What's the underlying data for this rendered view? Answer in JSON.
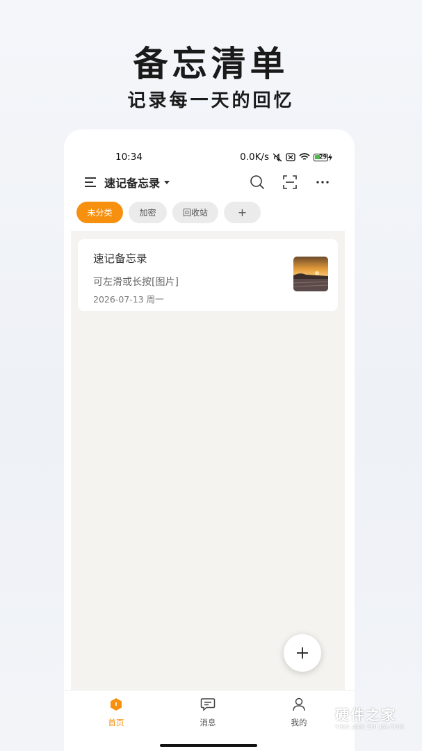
{
  "promo": {
    "title": "备忘清单",
    "subtitle": "记录每一天的回忆"
  },
  "status_bar": {
    "time": "10:34",
    "net_speed": "0.0K/s",
    "battery": "29"
  },
  "app_bar": {
    "title": "速记备忘录",
    "menu_icon": "menu-icon",
    "search_icon": "search-icon",
    "scan_icon": "scan-icon",
    "more_icon": "more-icon"
  },
  "categories": [
    {
      "label": "未分类",
      "active": true
    },
    {
      "label": "加密",
      "active": false
    },
    {
      "label": "回收站",
      "active": false
    },
    {
      "label": "+",
      "active": false
    }
  ],
  "notes": [
    {
      "title": "速记备忘录",
      "preview": "可左滑或长按[图片]",
      "date": "2026-07-13 周一",
      "thumbnail": "sunset-photo"
    }
  ],
  "fab": {
    "icon": "plus-icon"
  },
  "tabs": [
    {
      "label": "首页",
      "icon": "home-icon",
      "active": true
    },
    {
      "label": "消息",
      "icon": "message-icon",
      "active": false
    },
    {
      "label": "我的",
      "icon": "profile-icon",
      "active": false
    }
  ],
  "watermark": {
    "main": "硬件之家",
    "sub": "YING JIAN ZHI JIA.COM"
  },
  "colors": {
    "accent": "#f7900f",
    "content_bg": "#f4f3ef"
  }
}
